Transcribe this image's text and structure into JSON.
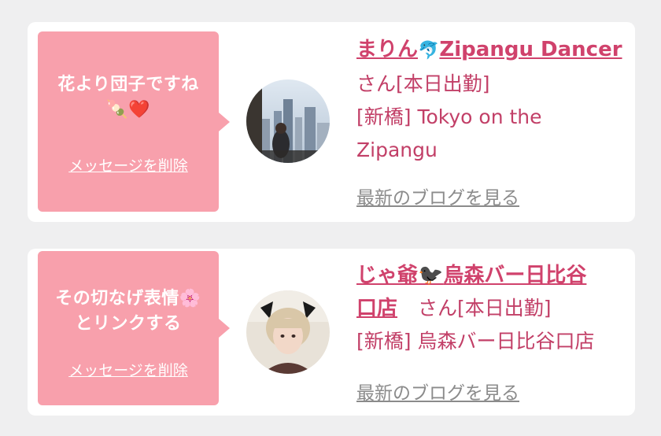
{
  "entries": [
    {
      "message": "花より団子ですね",
      "message_emoji": "🍡❤️",
      "delete_label": "メッセージを削除",
      "name_part1": "まりん",
      "name_icon": "🐬",
      "name_part2": "Zipangu Dancer",
      "suffix": "さん[本日出勤]",
      "area": "[新橋] Tokyo on the",
      "area_cont": "Zipangu",
      "blog_label": "最新のブログを見る"
    },
    {
      "message": "その切なげ表情",
      "message_emoji": "🌸",
      "message_line2": "とリンクする",
      "delete_label": "メッセージを削除",
      "name_part1": "じゃ爺",
      "name_icon": "🐦‍⬛",
      "name_part2": "烏森バー日比谷",
      "name_part3": "口店",
      "suffix": "さん[本日出勤]",
      "area": "[新橋] 烏森バー日比谷口店",
      "blog_label": "最新のブログを見る"
    }
  ],
  "colors": {
    "bubble": "#f8a0ac",
    "accent": "#d0426c",
    "text": "#c23f67",
    "link_gray": "#8b8b8b",
    "background": "#efeff0"
  }
}
